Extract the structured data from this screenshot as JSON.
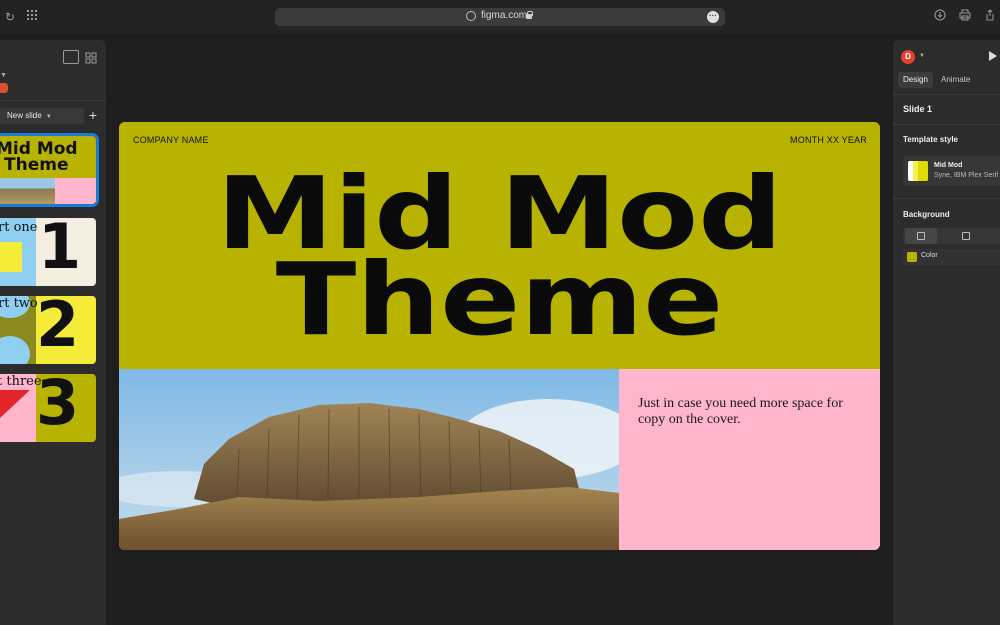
{
  "browser": {
    "url": "figma.com"
  },
  "left_panel": {
    "new_slide_label": "New slide",
    "add_label": "+",
    "thumbnails": [
      {
        "line1": "Mid Mod",
        "line2": "Theme"
      },
      {
        "text": "rt one",
        "number": "1"
      },
      {
        "text": "rt two",
        "number": "2"
      },
      {
        "text": "t three",
        "number": "3"
      }
    ]
  },
  "slide": {
    "company": "COMPANY NAME",
    "date": "MONTH XX YEAR",
    "title_line1": "Mid Mod",
    "title_line2": "Theme",
    "body": "Just in case you need more space for copy on the cover."
  },
  "right_panel": {
    "avatar_initial": "D",
    "tabs": [
      "Design",
      "Animate"
    ],
    "slide_label": "Slide 1",
    "template_style_heading": "Template style",
    "template_name": "Mid Mod",
    "template_fonts": "Syne, IBM Plex Serif",
    "background_heading": "Background",
    "color_label": "Color"
  },
  "colors": {
    "slide_bg": "#b7b300",
    "pink": "#ffb5cc",
    "selection": "#1a7ad8"
  },
  "icons": [
    "reload-icon",
    "grid-icon",
    "globe-icon",
    "lock-icon",
    "more-icon",
    "download-icon",
    "print-icon",
    "share-icon",
    "panel-toggle-icon",
    "grid-view-icon",
    "play-icon"
  ]
}
